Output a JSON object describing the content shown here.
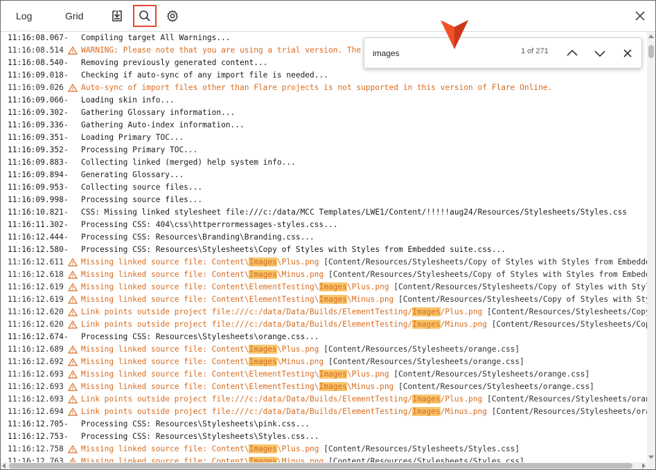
{
  "toolbar": {
    "tabs": [
      {
        "label": "Log",
        "active": true
      },
      {
        "label": "Grid",
        "active": false
      }
    ],
    "tools": [
      {
        "icon": "download-icon"
      },
      {
        "icon": "search-icon",
        "selected": true
      },
      {
        "icon": "gear-icon"
      }
    ],
    "close_icon": "close-icon"
  },
  "find": {
    "query": "images",
    "count": "1 of 271",
    "prev_icon": "chevron-up-icon",
    "next_icon": "chevron-down-icon",
    "close_icon": "close-icon"
  },
  "colors": {
    "accent": "#e2492e",
    "warning_text": "#d96b1e",
    "highlight": "#f7c56b",
    "pointer": "#f04e23"
  },
  "log": [
    {
      "ts": "11:16:08.067",
      "type": "info",
      "parts": [
        {
          "t": "Compiling target All Warnings..."
        }
      ]
    },
    {
      "ts": "11:16:08.514",
      "type": "warning",
      "parts": [
        {
          "t": "WARNING: Please note that you are using a trial version. The g"
        }
      ]
    },
    {
      "ts": "11:16:08.540",
      "type": "info",
      "parts": [
        {
          "t": "Removing previously generated content..."
        }
      ]
    },
    {
      "ts": "11:16:09.018",
      "type": "info",
      "parts": [
        {
          "t": "Checking if auto-sync of any import file is needed..."
        }
      ]
    },
    {
      "ts": "11:16:09.026",
      "type": "warning",
      "parts": [
        {
          "t": "Auto-sync of import files other than Flare projects is not supported in this version of Flare Online."
        }
      ]
    },
    {
      "ts": "11:16:09.066",
      "type": "info",
      "parts": [
        {
          "t": "Loading skin info..."
        }
      ]
    },
    {
      "ts": "11:16:09.302",
      "type": "info",
      "parts": [
        {
          "t": "Gathering Glossary information..."
        }
      ]
    },
    {
      "ts": "11:16:09.336",
      "type": "info",
      "parts": [
        {
          "t": "Gathering Auto-index information..."
        }
      ]
    },
    {
      "ts": "11:16:09.351",
      "type": "info",
      "parts": [
        {
          "t": "Loading Primary TOC..."
        }
      ]
    },
    {
      "ts": "11:16:09.352",
      "type": "info",
      "parts": [
        {
          "t": "Processing Primary TOC..."
        }
      ]
    },
    {
      "ts": "11:16:09.883",
      "type": "info",
      "parts": [
        {
          "t": "Collecting linked (merged) help system info..."
        }
      ]
    },
    {
      "ts": "11:16:09.894",
      "type": "info",
      "parts": [
        {
          "t": "Generating Glossary..."
        }
      ]
    },
    {
      "ts": "11:16:09.953",
      "type": "info",
      "parts": [
        {
          "t": "Collecting source files..."
        }
      ]
    },
    {
      "ts": "11:16:09.998",
      "type": "info",
      "parts": [
        {
          "t": "Processing source files..."
        }
      ]
    },
    {
      "ts": "11:16:10.821",
      "type": "info",
      "parts": [
        {
          "t": "CSS: Missing linked stylesheet file:///c:/data/MCC Templates/LWE1/Content/!!!!!aug24/Resources/Stylesheets/Styles.css"
        }
      ]
    },
    {
      "ts": "11:16:11.302",
      "type": "info",
      "parts": [
        {
          "t": "Processing CSS: 404\\css\\httperrormessages-styles.css..."
        }
      ]
    },
    {
      "ts": "11:16:12.444",
      "type": "info",
      "parts": [
        {
          "t": "Processing CSS: Resources\\Branding\\Branding.css..."
        }
      ]
    },
    {
      "ts": "11:16:12.580",
      "type": "info",
      "parts": [
        {
          "t": "Processing CSS: Resources\\Stylesheets\\Copy of Styles with Styles from Embedded suite.css..."
        }
      ]
    },
    {
      "ts": "11:16:12.611",
      "type": "warning",
      "parts": [
        {
          "t": "Missing linked source file: Content\\"
        },
        {
          "t": "Images",
          "hl": true
        },
        {
          "t": "\\Plus.png"
        },
        {
          "t": " [Content/Resources/Stylesheets/Copy of Styles with Styles from Embedded",
          "rest": true
        }
      ]
    },
    {
      "ts": "11:16:12.618",
      "type": "warning",
      "parts": [
        {
          "t": "Missing linked source file: Content\\"
        },
        {
          "t": "Images",
          "hl": true
        },
        {
          "t": "\\Minus.png"
        },
        {
          "t": " [Content/Resources/Stylesheets/Copy of Styles with Styles from Embedded",
          "rest": true
        }
      ]
    },
    {
      "ts": "11:16:12.619",
      "type": "warning",
      "parts": [
        {
          "t": "Missing linked source file: Content\\ElementTesting\\"
        },
        {
          "t": "Images",
          "hl": true
        },
        {
          "t": "\\Plus.png"
        },
        {
          "t": " [Content/Resources/Stylesheets/Copy of Styles with Styles",
          "rest": true
        }
      ]
    },
    {
      "ts": "11:16:12.619",
      "type": "warning",
      "parts": [
        {
          "t": "Missing linked source file: Content\\ElementTesting\\"
        },
        {
          "t": "Images",
          "hl": true
        },
        {
          "t": "\\Minus.png"
        },
        {
          "t": " [Content/Resources/Stylesheets/Copy of Styles with Style",
          "rest": true
        }
      ]
    },
    {
      "ts": "11:16:12.620",
      "type": "warning",
      "parts": [
        {
          "t": "Link points outside project file:///c:/data/Data/Builds/ElementTesting/"
        },
        {
          "t": "Images",
          "hl": true
        },
        {
          "t": "/Plus.png"
        },
        {
          "t": " [Content/Resources/Stylesheets/Copy o",
          "rest": true
        }
      ]
    },
    {
      "ts": "11:16:12.620",
      "type": "warning",
      "parts": [
        {
          "t": "Link points outside project file:///c:/data/Data/Builds/ElementTesting/"
        },
        {
          "t": "Images",
          "hl": true
        },
        {
          "t": "/Minus.png"
        },
        {
          "t": " [Content/Resources/Stylesheets/Copy",
          "rest": true
        }
      ]
    },
    {
      "ts": "11:16:12.674",
      "type": "info",
      "parts": [
        {
          "t": "Processing CSS: Resources\\Stylesheets\\orange.css..."
        }
      ]
    },
    {
      "ts": "11:16:12.689",
      "type": "warning",
      "parts": [
        {
          "t": "Missing linked source file: Content\\"
        },
        {
          "t": "Images",
          "hl": true
        },
        {
          "t": "\\Plus.png"
        },
        {
          "t": " [Content/Resources/Stylesheets/orange.css]",
          "rest": true
        }
      ]
    },
    {
      "ts": "11:16:12.692",
      "type": "warning",
      "parts": [
        {
          "t": "Missing linked source file: Content\\"
        },
        {
          "t": "Images",
          "hl": true
        },
        {
          "t": "\\Minus.png"
        },
        {
          "t": " [Content/Resources/Stylesheets/orange.css]",
          "rest": true
        }
      ]
    },
    {
      "ts": "11:16:12.693",
      "type": "warning",
      "parts": [
        {
          "t": "Missing linked source file: Content\\ElementTesting\\"
        },
        {
          "t": "Images",
          "hl": true
        },
        {
          "t": "\\Plus.png"
        },
        {
          "t": " [Content/Resources/Stylesheets/orange.css]",
          "rest": true
        }
      ]
    },
    {
      "ts": "11:16:12.693",
      "type": "warning",
      "parts": [
        {
          "t": "Missing linked source file: Content\\ElementTesting\\"
        },
        {
          "t": "Images",
          "hl": true
        },
        {
          "t": "\\Minus.png"
        },
        {
          "t": " [Content/Resources/Stylesheets/orange.css]",
          "rest": true
        }
      ]
    },
    {
      "ts": "11:16:12.693",
      "type": "warning",
      "parts": [
        {
          "t": "Link points outside project file:///c:/data/Data/Builds/ElementTesting/"
        },
        {
          "t": "Images",
          "hl": true
        },
        {
          "t": "/Plus.png"
        },
        {
          "t": " [Content/Resources/Stylesheets/orange",
          "rest": true
        }
      ]
    },
    {
      "ts": "11:16:12.694",
      "type": "warning",
      "parts": [
        {
          "t": "Link points outside project file:///c:/data/Data/Builds/ElementTesting/"
        },
        {
          "t": "Images",
          "hl": true
        },
        {
          "t": "/Minus.png"
        },
        {
          "t": " [Content/Resources/Stylesheets/orang",
          "rest": true
        }
      ]
    },
    {
      "ts": "11:16:12.705",
      "type": "info",
      "parts": [
        {
          "t": "Processing CSS: Resources\\Stylesheets\\pink.css..."
        }
      ]
    },
    {
      "ts": "11:16:12.753",
      "type": "info",
      "parts": [
        {
          "t": "Processing CSS: Resources\\Stylesheets\\Styles.css..."
        }
      ]
    },
    {
      "ts": "11:16:12.758",
      "type": "warning",
      "parts": [
        {
          "t": "Missing linked source file: Content\\"
        },
        {
          "t": "Images",
          "hl": true
        },
        {
          "t": "\\Plus.png"
        },
        {
          "t": " [Content/Resources/Stylesheets/Styles.css]",
          "rest": true
        }
      ]
    },
    {
      "ts": "11:16:12.763",
      "type": "warning",
      "parts": [
        {
          "t": "Missing linked source file: Content\\"
        },
        {
          "t": "Images",
          "hl": true
        },
        {
          "t": "\\Minus.png"
        },
        {
          "t": " [Content/Resources/Stylesheets/Styles.css]",
          "rest": true
        }
      ]
    }
  ]
}
